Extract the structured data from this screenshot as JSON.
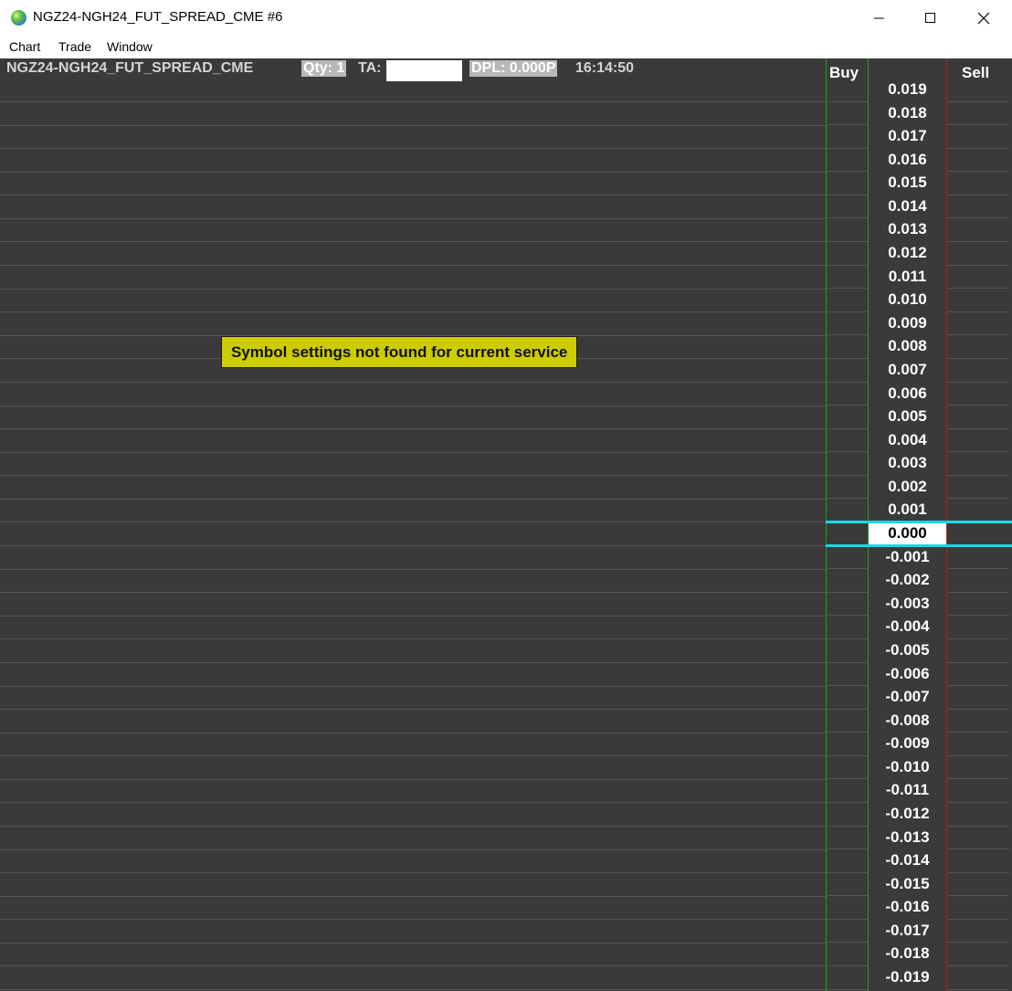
{
  "window": {
    "title": "NGZ24-NGH24_FUT_SPREAD_CME #6",
    "minimize_label": "—",
    "maximize_label": "☐",
    "close_label": "✕"
  },
  "menu": {
    "items": [
      "Chart",
      "Trade",
      "Window"
    ]
  },
  "header": {
    "symbol": "NGZ24-NGH24_FUT_SPREAD_CME",
    "qty": "Qty: 1",
    "ta_label": "TA:",
    "ta_value": "",
    "dpl": "DPL: 0.000P",
    "time": "16:14:50"
  },
  "message": "Symbol settings not found for current service",
  "dom": {
    "buy_label": "Buy",
    "sell_label": "Sell",
    "current_price": "0.000",
    "prices": [
      "0.019",
      "0.018",
      "0.017",
      "0.016",
      "0.015",
      "0.014",
      "0.013",
      "0.012",
      "0.011",
      "0.010",
      "0.009",
      "0.008",
      "0.007",
      "0.006",
      "0.005",
      "0.004",
      "0.003",
      "0.002",
      "0.001",
      "0.000",
      "-0.001",
      "-0.002",
      "-0.003",
      "-0.004",
      "-0.005",
      "-0.006",
      "-0.007",
      "-0.008",
      "-0.009",
      "-0.010",
      "-0.011",
      "-0.012",
      "-0.013",
      "-0.014",
      "-0.015",
      "-0.016",
      "-0.017",
      "-0.018",
      "-0.019"
    ]
  },
  "colors": {
    "background": "#3a3a3a",
    "buy_border": "#1e9e1e",
    "sell_border": "#b02020",
    "current_line": "#18d8e8",
    "message_bg": "#cccc00"
  }
}
